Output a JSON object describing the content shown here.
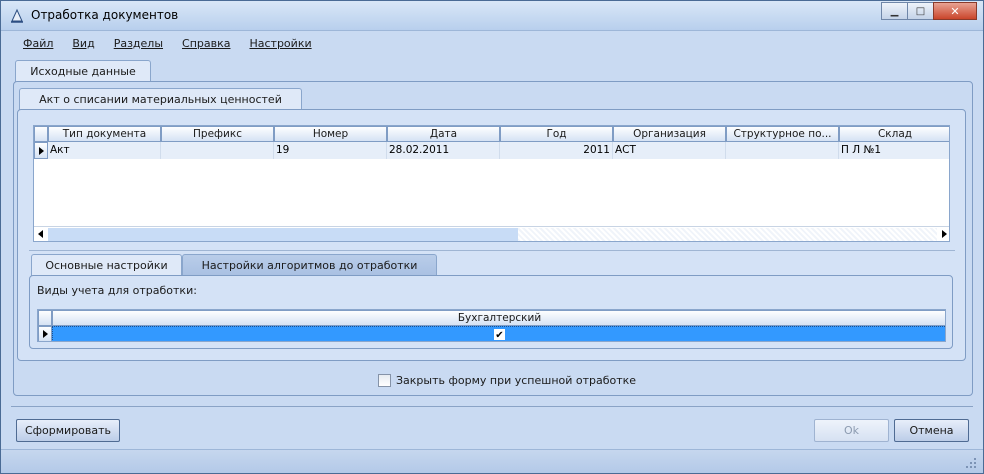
{
  "window": {
    "title": "Отработка документов",
    "minimize": "▁",
    "maximize": "□",
    "close": "✕"
  },
  "menu": [
    "Файл",
    "Вид",
    "Разделы",
    "Справка",
    "Настройки"
  ],
  "tabs": {
    "outer": "Исходные данные",
    "document": "Акт о списании материальных ценностей",
    "settings": [
      "Основные настройки",
      "Настройки алгоритмов до отработки"
    ]
  },
  "documents_table": {
    "columns": [
      "Тип документа",
      "Префикс",
      "Номер",
      "Дата",
      "Год",
      "Организация",
      "Структурное по...",
      "Склад"
    ],
    "rows": [
      [
        "Акт",
        "",
        "19",
        "28.02.2011",
        "2011",
        "АСТ",
        "",
        "П Л №1"
      ]
    ]
  },
  "accounting": {
    "label": "Виды учета для отработки:",
    "columns": [
      "Бухгалтерский"
    ],
    "rows": [
      {
        "checked": "✔"
      }
    ]
  },
  "close_on_success_label": "Закрыть форму при успешной отработке",
  "buttons": {
    "generate": "Сформировать",
    "ok": "Ok",
    "cancel": "Отмена"
  },
  "colors": {
    "selected_row": "#3399ff",
    "window_bg": "#c9daf2"
  }
}
